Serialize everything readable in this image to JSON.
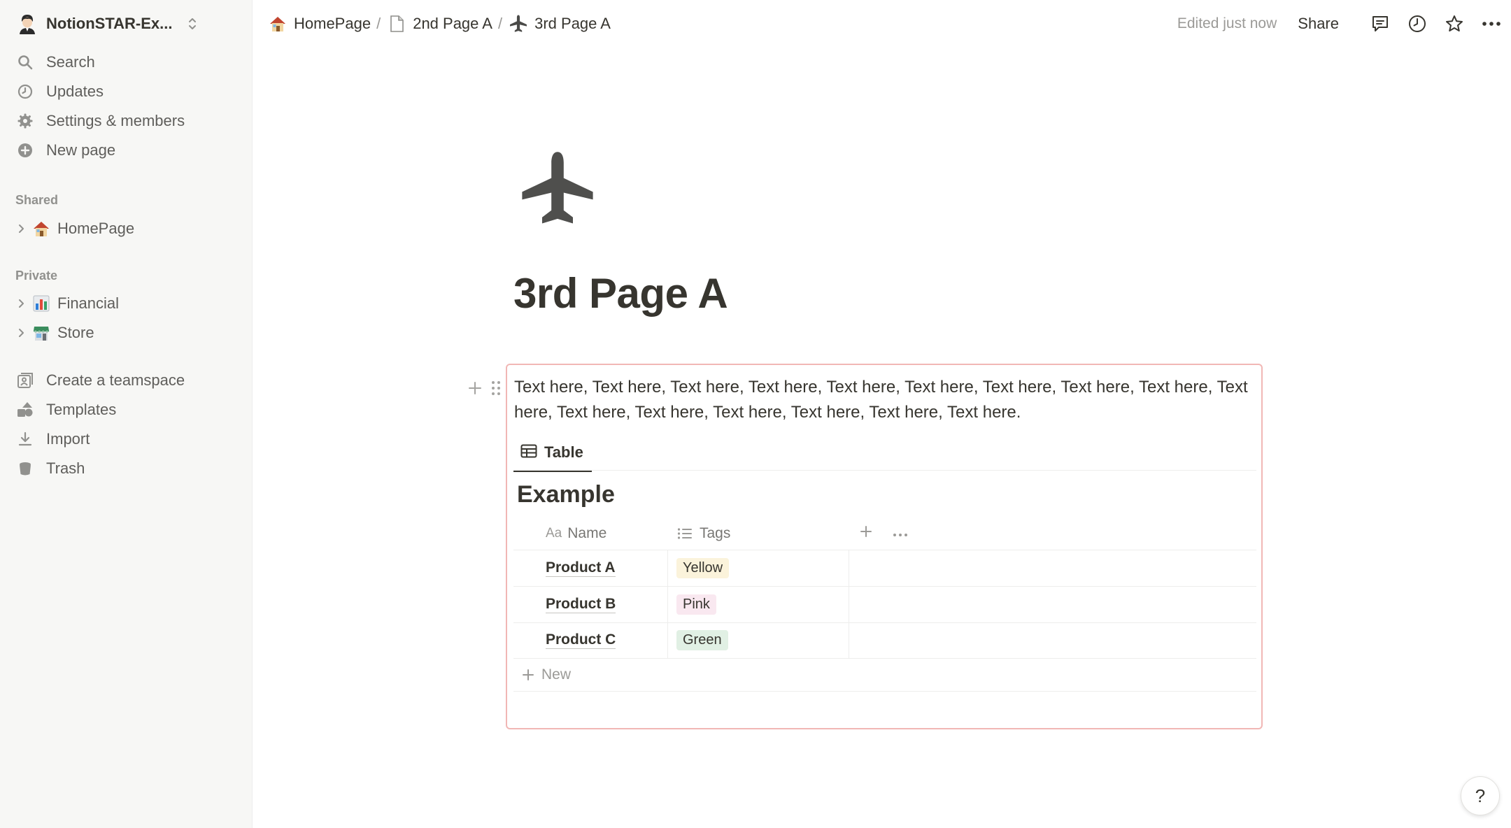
{
  "workspace": {
    "name": "NotionSTAR-Ex..."
  },
  "sidebar": {
    "top_items": [
      {
        "label": "Search",
        "icon": "search-icon"
      },
      {
        "label": "Updates",
        "icon": "clock-icon"
      },
      {
        "label": "Settings & members",
        "icon": "gear-icon"
      },
      {
        "label": "New page",
        "icon": "plus-circle-icon"
      }
    ],
    "shared_label": "Shared",
    "shared_pages": [
      {
        "label": "HomePage",
        "emoji": "🏠"
      }
    ],
    "private_label": "Private",
    "private_pages": [
      {
        "label": "Financial",
        "emoji": "📊"
      },
      {
        "label": "Store",
        "emoji": "🏪"
      }
    ],
    "bottom_items": [
      {
        "label": "Create a teamspace",
        "icon": "teamspace-icon"
      },
      {
        "label": "Templates",
        "icon": "templates-icon"
      },
      {
        "label": "Import",
        "icon": "download-icon"
      },
      {
        "label": "Trash",
        "icon": "trash-icon"
      }
    ]
  },
  "breadcrumb": [
    {
      "label": "HomePage",
      "icon": "house-emoji"
    },
    {
      "label": "2nd Page A",
      "icon": "page-icon"
    },
    {
      "label": "3rd Page A",
      "icon": "airplane-icon"
    }
  ],
  "topbar": {
    "edited": "Edited just now",
    "share": "Share"
  },
  "page": {
    "title": "3rd Page A",
    "icon": "airplane-icon",
    "paragraph": "Text here, Text here, Text here, Text here, Text here, Text here, Text here, Text here, Text here, Text here, Text here, Text here, Text here, Text here, Text here, Text here."
  },
  "database": {
    "view_tab": "Table",
    "title": "Example",
    "columns": [
      {
        "label": "Name",
        "icon": "Aa"
      },
      {
        "label": "Tags",
        "icon": "list-icon"
      }
    ],
    "rows": [
      {
        "name": "Product A",
        "tag": "Yellow",
        "tag_color": "#fbf3db"
      },
      {
        "name": "Product B",
        "tag": "Pink",
        "tag_color": "#f9e8f0"
      },
      {
        "name": "Product C",
        "tag": "Green",
        "tag_color": "#e1f0e4"
      }
    ],
    "new_label": "New"
  },
  "help": {
    "label": "?"
  },
  "colors": {
    "selection_border": "#f1b7b5",
    "sidebar_bg": "#f7f7f5"
  }
}
